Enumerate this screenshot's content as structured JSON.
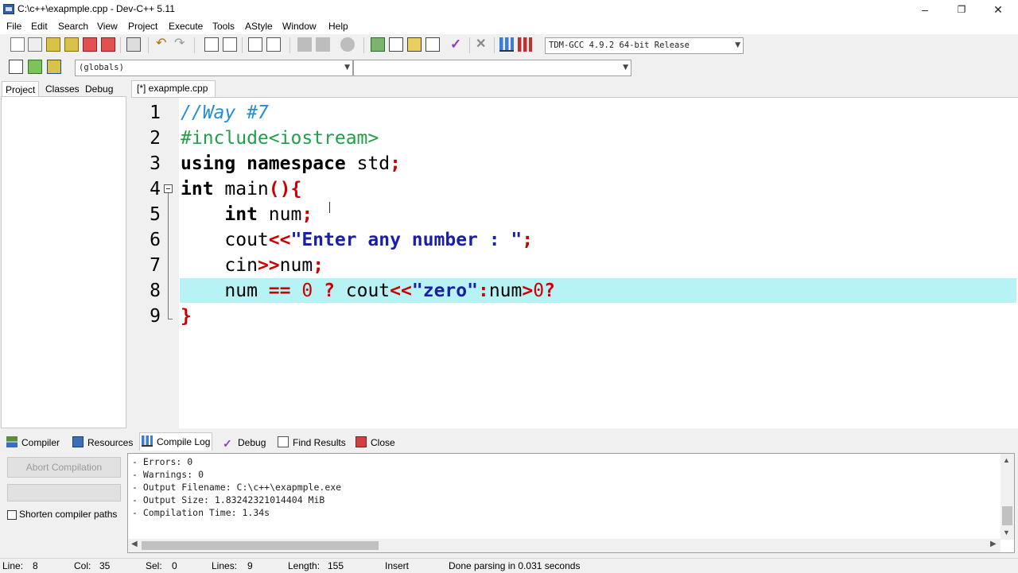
{
  "window": {
    "title": "C:\\c++\\exapmple.cpp - Dev-C++ 5.11"
  },
  "menu": [
    "File",
    "Edit",
    "Search",
    "View",
    "Project",
    "Execute",
    "Tools",
    "AStyle",
    "Window",
    "Help"
  ],
  "toolbar": {
    "compiler_select": "TDM-GCC 4.9.2 64-bit Release",
    "scope_select": "(globals)",
    "member_select": ""
  },
  "left_tabs": [
    "Project",
    "Classes",
    "Debug"
  ],
  "editor": {
    "tab": "[*] exapmple.cpp",
    "line_numbers": [
      "1",
      "2",
      "3",
      "4",
      "5",
      "6",
      "7",
      "8",
      "9"
    ]
  },
  "bottom_tabs": {
    "compiler": "Compiler",
    "resources": "Resources",
    "compile_log": "Compile Log",
    "debug": "Debug",
    "find_results": "Find Results",
    "close": "Close"
  },
  "compile_panel": {
    "abort_button": "Abort Compilation",
    "shorten_paths_label": "Shorten compiler paths",
    "log_lines": [
      "- Errors: 0",
      "- Warnings: 0",
      "- Output Filename: C:\\c++\\exapmple.exe",
      "- Output Size: 1.83242321014404 MiB",
      "- Compilation Time: 1.34s"
    ]
  },
  "status": {
    "line_label": "Line:",
    "line_value": "8",
    "col_label": "Col:",
    "col_value": "35",
    "sel_label": "Sel:",
    "sel_value": "0",
    "lines_label": "Lines:",
    "lines_value": "9",
    "length_label": "Length:",
    "length_value": "155",
    "mode": "Insert",
    "message": "Done parsing in 0.031 seconds"
  }
}
